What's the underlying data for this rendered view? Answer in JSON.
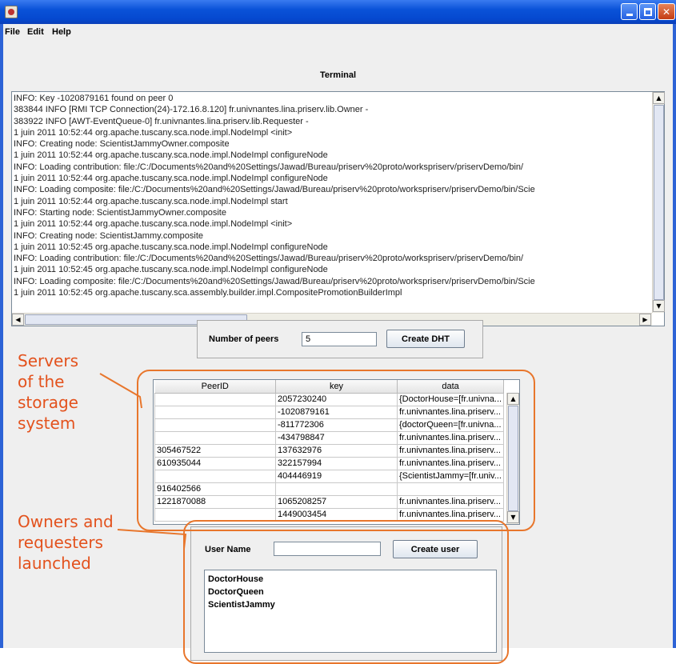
{
  "menu": [
    "File",
    "Edit",
    "Help"
  ],
  "terminal": {
    "title": "Terminal",
    "lines": [
      "INFO: Key -1020879161 found on peer 0",
      "383844 INFO  [RMI TCP Connection(24)-172.16.8.120] fr.univnantes.lina.priserv.lib.Owner   -",
      "383922 INFO  [AWT-EventQueue-0] fr.univnantes.lina.priserv.lib.Requester   -",
      "1 juin 2011 10:52:44 org.apache.tuscany.sca.node.impl.NodeImpl <init>",
      "INFO: Creating node: ScientistJammyOwner.composite",
      "1 juin 2011 10:52:44 org.apache.tuscany.sca.node.impl.NodeImpl configureNode",
      "INFO: Loading contribution: file:/C:/Documents%20and%20Settings/Jawad/Bureau/priserv%20proto/workspriserv/priservDemo/bin/",
      "1 juin 2011 10:52:44 org.apache.tuscany.sca.node.impl.NodeImpl configureNode",
      "INFO: Loading composite: file:/C:/Documents%20and%20Settings/Jawad/Bureau/priserv%20proto/workspriserv/priservDemo/bin/Scie",
      "1 juin 2011 10:52:44 org.apache.tuscany.sca.node.impl.NodeImpl start",
      "INFO: Starting node: ScientistJammyOwner.composite",
      "1 juin 2011 10:52:44 org.apache.tuscany.sca.node.impl.NodeImpl <init>",
      "INFO: Creating node: ScientistJammy.composite",
      "1 juin 2011 10:52:45 org.apache.tuscany.sca.node.impl.NodeImpl configureNode",
      "INFO: Loading contribution: file:/C:/Documents%20and%20Settings/Jawad/Bureau/priserv%20proto/workspriserv/priservDemo/bin/",
      "1 juin 2011 10:52:45 org.apache.tuscany.sca.node.impl.NodeImpl configureNode",
      "INFO: Loading composite: file:/C:/Documents%20and%20Settings/Jawad/Bureau/priserv%20proto/workspriserv/priservDemo/bin/Scie",
      "1 juin 2011 10:52:45 org.apache.tuscany.sca.assembly.builder.impl.CompositePromotionBuilderImpl"
    ]
  },
  "dht": {
    "label": "Number of peers",
    "value": "5",
    "button": "Create DHT"
  },
  "table": {
    "headers": [
      "PeerID",
      "key",
      "data"
    ],
    "rows": [
      [
        "",
        "2057230240",
        "{DoctorHouse=[fr.univna..."
      ],
      [
        "",
        "-1020879161",
        "fr.univnantes.lina.priserv..."
      ],
      [
        "",
        "-811772306",
        "{doctorQueen=[fr.univna..."
      ],
      [
        "",
        "-434798847",
        "fr.univnantes.lina.priserv..."
      ],
      [
        "305467522",
        "137632976",
        "fr.univnantes.lina.priserv..."
      ],
      [
        "610935044",
        "322157994",
        "fr.univnantes.lina.priserv..."
      ],
      [
        "",
        "404446919",
        "{ScientistJammy=[fr.univ..."
      ],
      [
        "916402566",
        "",
        ""
      ],
      [
        "1221870088",
        "1065208257",
        "fr.univnantes.lina.priserv..."
      ],
      [
        "",
        "1449003454",
        "fr.univnantes.lina.priserv..."
      ]
    ]
  },
  "user": {
    "label": "User Name",
    "value": "",
    "button": "Create user",
    "list": [
      "DoctorHouse",
      "DoctorQueen",
      "ScientistJammy"
    ]
  },
  "annotations": {
    "servers": [
      "Servers",
      "of the",
      "storage",
      "system"
    ],
    "owners": [
      "Owners and",
      "requesters",
      "launched"
    ],
    "color": "#e3521d"
  }
}
